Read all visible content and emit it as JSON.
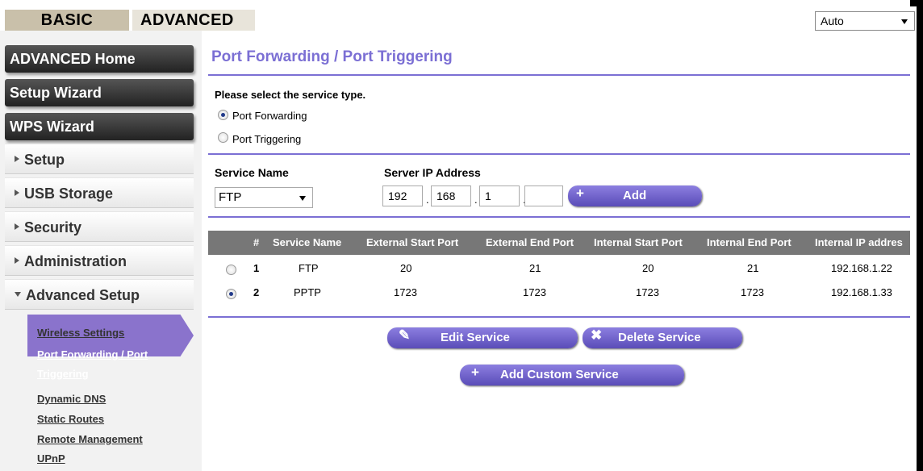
{
  "tabs": {
    "basic": "BASIC",
    "advanced": "ADVANCED"
  },
  "language_select": {
    "value": "Auto"
  },
  "sidebar": {
    "advanced_home": "ADVANCED Home",
    "setup_wizard": "Setup Wizard",
    "wps_wizard": "WPS Wizard",
    "sections": [
      {
        "label": "Setup"
      },
      {
        "label": "USB Storage"
      },
      {
        "label": "Security"
      },
      {
        "label": "Administration"
      },
      {
        "label": "Advanced Setup"
      }
    ],
    "sub_links": {
      "wireless": "Wireless Settings",
      "port_forwarding_1": "Port Forwarding / Port",
      "port_forwarding_2": "Triggering",
      "dynamic_dns": "Dynamic DNS",
      "static_routes": "Static Routes",
      "remote_mgmt": "Remote Management",
      "upnp": "UPnP"
    }
  },
  "main": {
    "title": "Port Forwarding / Port Triggering",
    "select_service_type": "Please select the service type.",
    "radio_forwarding": "Port Forwarding",
    "radio_triggering": "Port Triggering",
    "service_name_label": "Service Name",
    "server_ip_label": "Server IP Address",
    "service_name_value": "FTP",
    "ip": {
      "o1": "192",
      "o2": "168",
      "o3": "1",
      "o4": ""
    },
    "add_button": "Add",
    "table": {
      "headers": [
        "#",
        "Service Name",
        "External Start Port",
        "External End Port",
        "Internal Start Port",
        "Internal End Port",
        "Internal IP addres"
      ],
      "rows": [
        {
          "num": "1",
          "service": "FTP",
          "ext_start": "20",
          "ext_end": "21",
          "int_start": "20",
          "int_end": "21",
          "ip": "192.168.1.22"
        },
        {
          "num": "2",
          "service": "PPTP",
          "ext_start": "1723",
          "ext_end": "1723",
          "int_start": "1723",
          "int_end": "1723",
          "ip": "192.168.1.33"
        }
      ]
    },
    "edit_button": "Edit Service",
    "delete_button": "Delete Service",
    "add_custom_button": "Add Custom Service"
  },
  "colors": {
    "accent": "#7b6fd4",
    "sidebar_active": "#8a73cc",
    "table_header": "#777777"
  },
  "icons": {
    "edit": "pencil-icon",
    "delete": "x-icon",
    "add": "plus-icon"
  }
}
